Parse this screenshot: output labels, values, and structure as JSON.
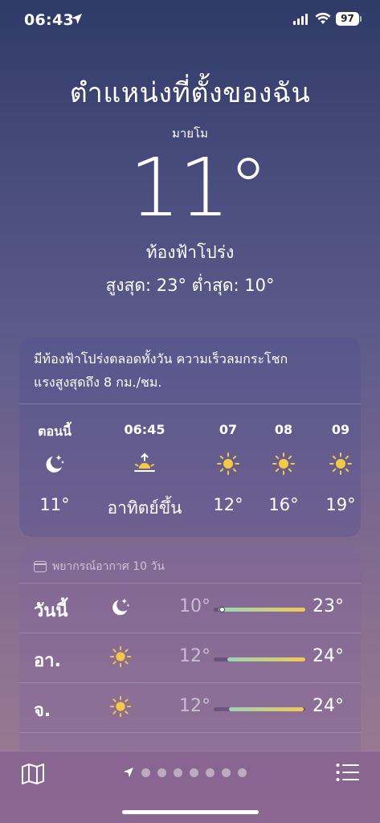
{
  "status_bar": {
    "time": "06:43",
    "battery": "97"
  },
  "header": {
    "title": "ตำแหน่งที่ตั้งของฉัน",
    "sublocation": "มายโม",
    "temperature": "11°",
    "condition": "ท้องฟ้าโปร่ง",
    "high_low": "สูงสุด: 23°  ต่ำสุด: 10°"
  },
  "hourly": {
    "summary_line1": "มีท้องฟ้าโปร่งตลอดทั้งวัน ความเร็วลมกระโชก",
    "summary_line2": "แรงสูงสุดถึง 8 กม./ชม.",
    "hours": [
      {
        "label": "ตอนนี้",
        "icon": "moon-stars-icon",
        "temp": "11°"
      },
      {
        "label": "06:45",
        "icon": "sunrise-icon",
        "temp": "อาทิตย์ขึ้น"
      },
      {
        "label": "07",
        "icon": "sun-icon",
        "temp": "12°"
      },
      {
        "label": "08",
        "icon": "sun-icon",
        "temp": "16°"
      },
      {
        "label": "09",
        "icon": "sun-icon",
        "temp": "19°"
      }
    ]
  },
  "daily": {
    "header": "พยากรณ์อากาศ 10 วัน",
    "days": [
      {
        "day": "วันนี้",
        "icon": "moon-stars-icon",
        "low": "10°",
        "high": "23°",
        "range_start": 0.05,
        "range_end": 1.0,
        "current": 0.09
      },
      {
        "day": "อา.",
        "icon": "sun-icon",
        "low": "12°",
        "high": "24°",
        "range_start": 0.15,
        "range_end": 1.0
      },
      {
        "day": "จ.",
        "icon": "sun-icon",
        "low": "12°",
        "high": "24°",
        "range_start": 0.17,
        "range_end": 0.98
      }
    ]
  },
  "colors": {
    "sun": "#f6c945",
    "accent_bar_start": "#9bd5b2",
    "accent_bar_end": "#f0c85a"
  }
}
